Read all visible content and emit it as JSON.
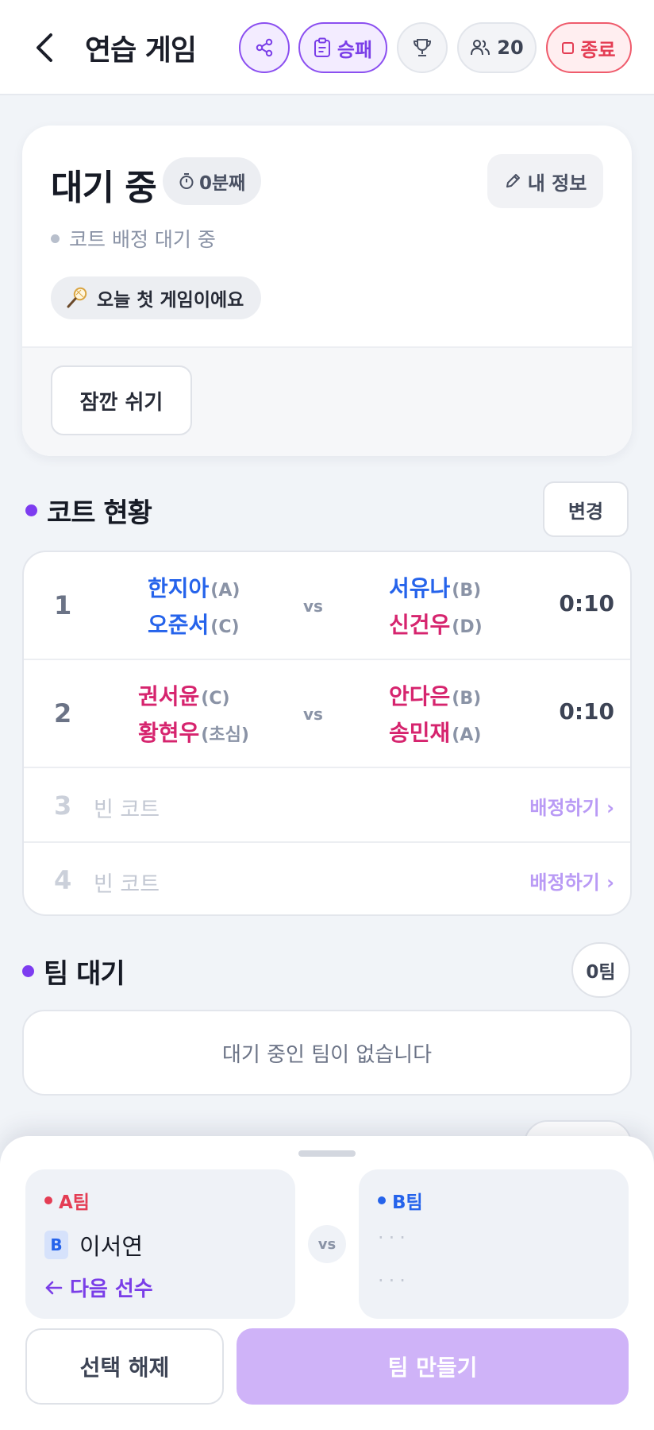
{
  "header": {
    "title": "연습 게임",
    "result_label": "승패",
    "player_count": "20",
    "end_label": "종료"
  },
  "status": {
    "title": "대기 중",
    "elapsed": "0분째",
    "my_info_label": "내 정보",
    "court_wait": "코트 배정 대기 중",
    "first_game": "오늘 첫 게임이에요",
    "break_label": "잠깐 쉬기"
  },
  "courts_section": {
    "title": "코트 현황",
    "change_label": "변경",
    "vs": "vs",
    "courts": [
      {
        "num": "1",
        "team1": [
          {
            "name": "한지아",
            "grade": "(A)"
          },
          {
            "name": "오준서",
            "grade": "(C)"
          }
        ],
        "team2": [
          {
            "name": "서유나",
            "grade": "(B)"
          },
          {
            "name": "신건우",
            "grade": "(D)"
          }
        ],
        "time": "0:10"
      },
      {
        "num": "2",
        "team1": [
          {
            "name": "권서윤",
            "grade": "(C)"
          },
          {
            "name": "황현우",
            "grade": "(초심)"
          }
        ],
        "team2": [
          {
            "name": "안다은",
            "grade": "(B)"
          },
          {
            "name": "송민재",
            "grade": "(A)"
          }
        ],
        "time": "0:10"
      },
      {
        "num": "3",
        "empty_label": "빈 코트",
        "assign_label": "배정하기 ›"
      },
      {
        "num": "4",
        "empty_label": "빈 코트",
        "assign_label": "배정하기 ›"
      }
    ]
  },
  "team_wait": {
    "title": "팀 대기",
    "count": "0팀",
    "empty_message": "대기 중인 팀이 없습니다"
  },
  "sheet": {
    "team_a": {
      "label": "A팀",
      "member_grade": "B",
      "member_name": "이서연",
      "next_player": "다음 선수"
    },
    "vs": "vs",
    "team_b": {
      "label": "B팀",
      "placeholder1": "···",
      "placeholder2": "···"
    },
    "deselect_label": "선택 해제",
    "make_team_label": "팀 만들기"
  },
  "colors": {
    "accent_purple": "#7d3cf0",
    "team_blue": "#2563eb",
    "team_pink": "#d6246e",
    "danger_red": "#e43d54"
  }
}
